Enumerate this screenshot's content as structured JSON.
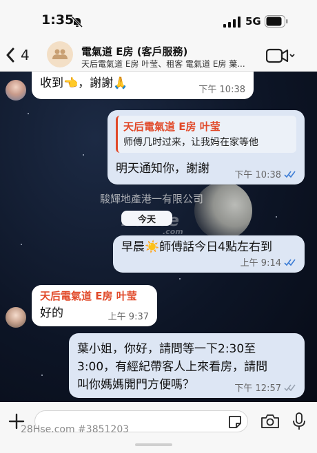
{
  "status_bar": {
    "time": "1:35",
    "network": "5G",
    "icons": [
      "bell-slash-icon",
      "signal-icon",
      "battery-icon"
    ]
  },
  "header": {
    "back_count": "4",
    "title": "電氣道 E房 (客戶服務)",
    "subtitle": "天后電氣道 E房 叶莹、租客 電氣道 E房 葉...",
    "icons": [
      "back-chevron-icon",
      "group-icon",
      "video-icon",
      "chevron-down-icon"
    ]
  },
  "watermarks": {
    "logo": "28Hse",
    "logo_domain": ".com",
    "company": "駿輝地產港一有限公司",
    "footer": "28Hse.com #3851203"
  },
  "messages": [
    {
      "direction": "in",
      "text": "收到👈，謝謝🙏",
      "time": "下午 10:38"
    },
    {
      "direction": "out",
      "quote_name": "天后電氣道 E房 叶莹",
      "quote_text": "师傅几时过来，让我妈在家等他",
      "text": "明天通知你，謝謝",
      "time": "下午 10:38",
      "read": true
    },
    {
      "type": "date",
      "text": "今天"
    },
    {
      "direction": "out",
      "text": "早晨☀️師傅話今日4點左右到",
      "time": "上午 9:14",
      "read": true
    },
    {
      "direction": "in",
      "sender": "天后電氣道 E房 叶莹",
      "text": "好的",
      "time": "上午 9:37"
    },
    {
      "direction": "out",
      "text_lines": [
        "葉小姐，你好，請問等一下2:30至",
        "3:00，有經紀帶客人上來看房，請問",
        "叫你媽媽開門方便嗎？"
      ],
      "time": "下午 12:57",
      "read": true
    }
  ],
  "input": {
    "placeholder": "",
    "value": ""
  },
  "colors": {
    "sender_name": "#e14a2a",
    "outgoing_bubble": "#dde6f4",
    "incoming_bubble": "#ffffff",
    "read_ticks": "#3a7bd5"
  }
}
